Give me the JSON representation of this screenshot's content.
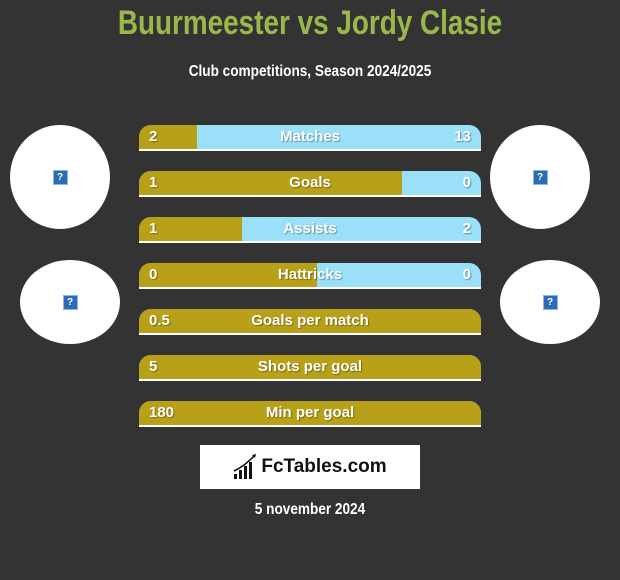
{
  "header": {
    "title": "Buurmeester vs Jordy Clasie",
    "subtitle": "Club competitions, Season 2024/2025"
  },
  "colors": {
    "left_player": "#b8a118",
    "right_player": "#99e0f8",
    "title": "#9ab84a",
    "background": "#333333"
  },
  "stats": [
    {
      "label": "Matches",
      "left": "2",
      "right": "13",
      "left_share": 0.17
    },
    {
      "label": "Goals",
      "left": "1",
      "right": "0",
      "left_share": 0.77
    },
    {
      "label": "Assists",
      "left": "1",
      "right": "2",
      "left_share": 0.3
    },
    {
      "label": "Hattricks",
      "left": "0",
      "right": "0",
      "left_share": 0.52
    },
    {
      "label": "Goals per match",
      "left": "0.5",
      "right": "",
      "left_share": 1.0
    },
    {
      "label": "Shots per goal",
      "left": "5",
      "right": "",
      "left_share": 1.0
    },
    {
      "label": "Min per goal",
      "left": "180",
      "right": "",
      "left_share": 1.0
    }
  ],
  "avatars": {
    "icon": "broken-image-icon",
    "glyph": "?"
  },
  "logo": {
    "text": "FcTables.com",
    "icon": "bar-chart-icon"
  },
  "footer": {
    "date": "5 november 2024"
  }
}
